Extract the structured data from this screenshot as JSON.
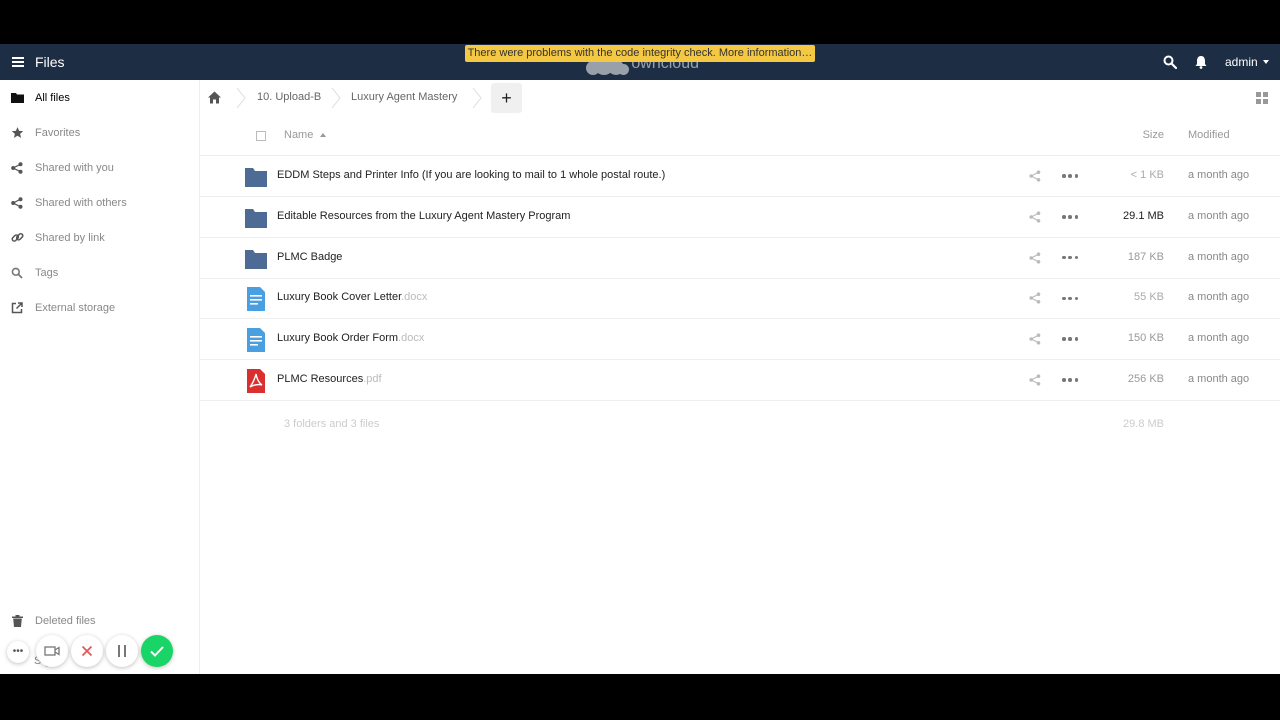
{
  "header": {
    "app_title": "Files",
    "integrity_warning": "There were problems with the code integrity check. More information…",
    "logo_text": "owncloud",
    "user": "admin"
  },
  "sidebar": {
    "items": [
      {
        "label": "All files",
        "icon": "folder-icon",
        "active": true
      },
      {
        "label": "Favorites",
        "icon": "star-icon"
      },
      {
        "label": "Shared with you",
        "icon": "share-icon"
      },
      {
        "label": "Shared with others",
        "icon": "share-icon"
      },
      {
        "label": "Shared by link",
        "icon": "link-icon"
      },
      {
        "label": "Tags",
        "icon": "search-icon"
      },
      {
        "label": "External storage",
        "icon": "external-link-icon"
      }
    ],
    "deleted_files": "Deleted files",
    "settings_partial": "S      gs"
  },
  "breadcrumb": {
    "items": [
      "10. Upload-B",
      "Luxury Agent Mastery"
    ],
    "new_label": "+"
  },
  "table": {
    "headers": {
      "name": "Name",
      "size": "Size",
      "modified": "Modified"
    },
    "rows": [
      {
        "name": "EDDM Steps and Printer Info (If you are looking to mail to 1 whole postal route.)",
        "ext": "",
        "type": "folder",
        "size": "< 1 KB",
        "modified": "a month ago",
        "size_color": "#aaaaaa"
      },
      {
        "name": "Editable Resources from the Luxury Agent Mastery Program",
        "ext": "",
        "type": "folder",
        "size": "29.1 MB",
        "modified": "a month ago",
        "size_color": "#222222"
      },
      {
        "name": "PLMC Badge",
        "ext": "",
        "type": "folder",
        "size": "187 KB",
        "modified": "a month ago",
        "size_color": "#999999"
      },
      {
        "name": "Luxury Book Cover Letter",
        "ext": ".docx",
        "type": "doc",
        "size": "55 KB",
        "modified": "a month ago",
        "size_color": "#aaaaaa"
      },
      {
        "name": "Luxury Book Order Form",
        "ext": ".docx",
        "type": "doc",
        "size": "150 KB",
        "modified": "a month ago",
        "size_color": "#999999"
      },
      {
        "name": "PLMC Resources",
        "ext": ".pdf",
        "type": "pdf",
        "size": "256 KB",
        "modified": "a month ago",
        "size_color": "#999999"
      }
    ],
    "summary": "3 folders and 3 files",
    "summary_size": "29.8 MB"
  },
  "colors": {
    "header_bg": "#1d2d44",
    "folder": "#4d6b94",
    "doc": "#4a9fe0",
    "pdf": "#d9302f",
    "warning": "#f4c842",
    "confirm": "#19d466"
  }
}
